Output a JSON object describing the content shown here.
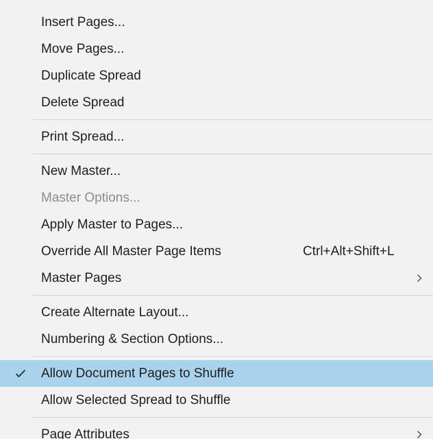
{
  "menu": {
    "items": [
      {
        "label": "Insert Pages..."
      },
      {
        "label": "Move Pages..."
      },
      {
        "label": "Duplicate Spread"
      },
      {
        "label": "Delete Spread"
      },
      {
        "label": "Print Spread..."
      },
      {
        "label": "New Master..."
      },
      {
        "label": "Master Options...",
        "disabled": true
      },
      {
        "label": "Apply Master to Pages..."
      },
      {
        "label": "Override All Master Page Items",
        "shortcut": "Ctrl+Alt+Shift+L"
      },
      {
        "label": "Master Pages",
        "submenu": true
      },
      {
        "label": "Create Alternate Layout..."
      },
      {
        "label": "Numbering & Section Options..."
      },
      {
        "label": "Allow Document Pages to Shuffle",
        "checked": true
      },
      {
        "label": "Allow Selected Spread to Shuffle"
      },
      {
        "label": "Page Attributes",
        "submenu": true
      }
    ]
  },
  "icons": {
    "check": "checkmark-icon",
    "submenu": "chevron-right-icon"
  },
  "colors": {
    "menu_background": "#f2f2f2",
    "text": "#1e1e1e",
    "disabled_text": "#8c8c8c",
    "highlight": "#a9d2ec",
    "separator": "#d4d4d4"
  }
}
